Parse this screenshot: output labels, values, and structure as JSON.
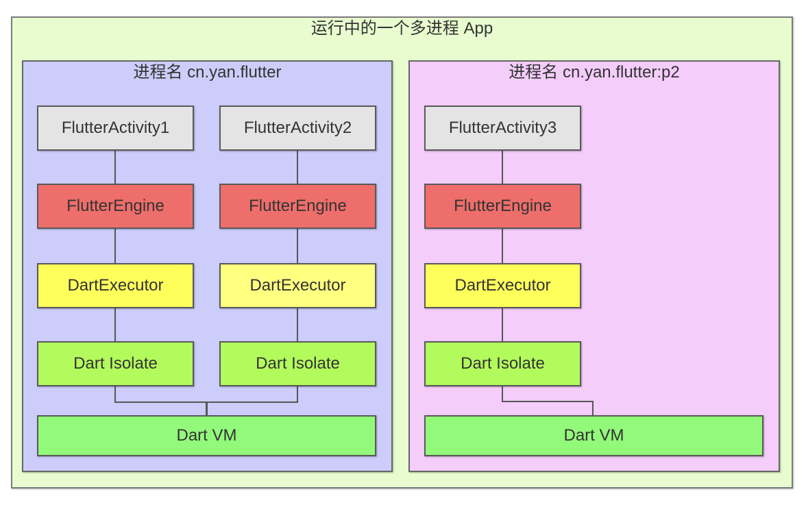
{
  "app": {
    "title": "运行中的一个多进程 App",
    "background": "#e8fccf"
  },
  "processes": [
    {
      "title": "进程名 cn.yan.flutter",
      "background": "#cccdfa",
      "columns": [
        {
          "activity": "FlutterActivity1",
          "engine": "FlutterEngine",
          "executor": "DartExecutor",
          "isolate": "Dart Isolate"
        },
        {
          "activity": "FlutterActivity2",
          "engine": "FlutterEngine",
          "executor": "DartExecutor",
          "isolate": "Dart Isolate"
        }
      ],
      "vm": "Dart VM"
    },
    {
      "title": "进程名 cn.yan.flutter:p2",
      "background": "#f4cdfa",
      "columns": [
        {
          "activity": "FlutterActivity3",
          "engine": "FlutterEngine",
          "executor": "DartExecutor",
          "isolate": "Dart Isolate"
        }
      ],
      "vm": "Dart VM"
    }
  ],
  "colors": {
    "activity": "#e4e4e4",
    "engine": "#ee6e6b",
    "executor": "#ffff5c",
    "isolate": "#b3fb5c",
    "vm": "#92f97a"
  }
}
